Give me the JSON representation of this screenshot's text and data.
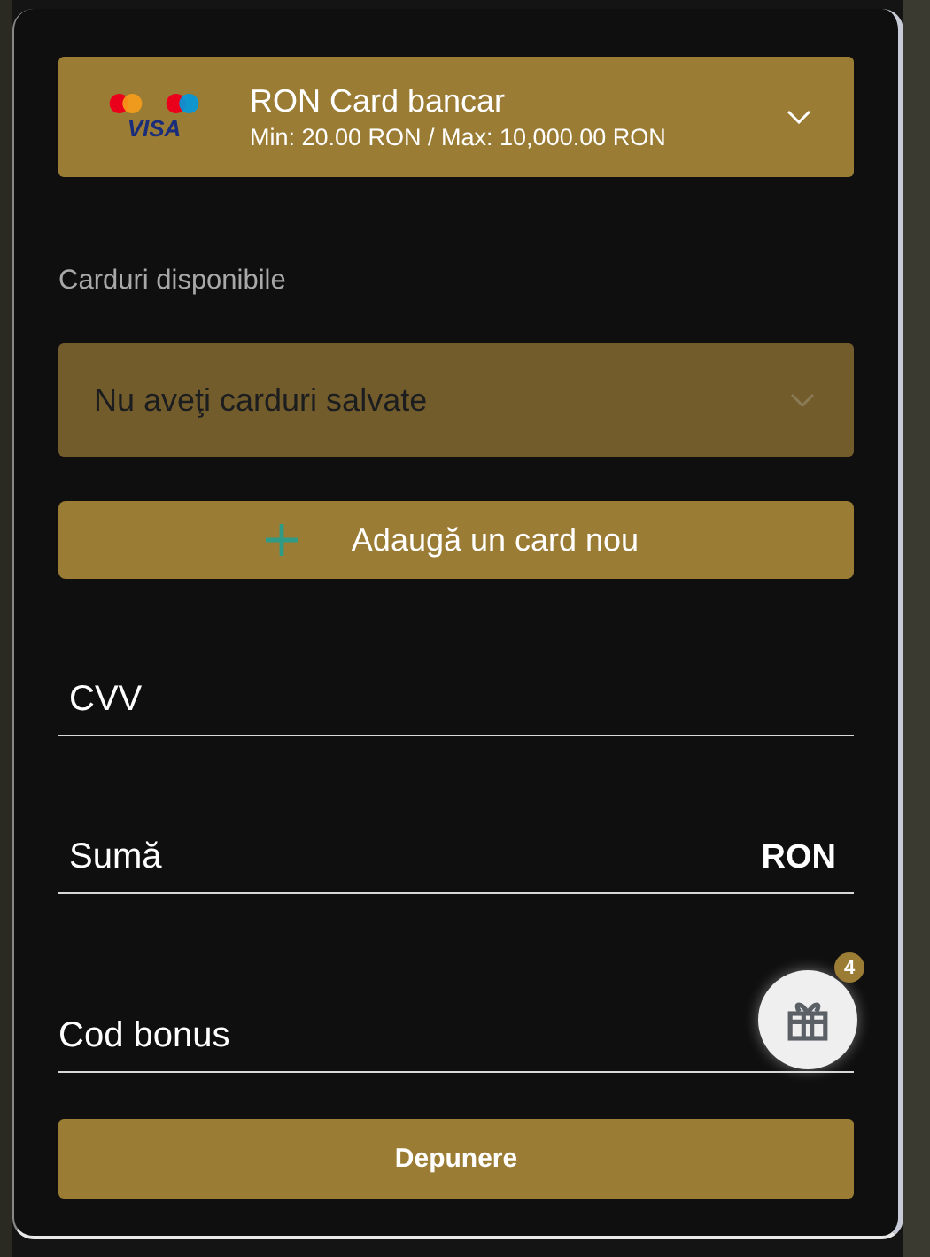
{
  "payment_method": {
    "visa_logo": "VISA",
    "title": "RON Card bancar",
    "limits": "Min: 20.00 RON / Max: 10,000.00 RON",
    "expanded": false
  },
  "saved_cards": {
    "label": "Carduri disponibile",
    "placeholder": "Nu aveţi carduri salvate",
    "disabled": true
  },
  "add_card_button": {
    "label": "Adaugă un card nou"
  },
  "fields": [
    {
      "kind": "text",
      "placeholder": "CVV"
    },
    {
      "kind": "amount",
      "placeholder": "Sumă",
      "suffix": "RON"
    },
    {
      "kind": "bonus",
      "placeholder": "Cod bonus"
    }
  ],
  "bonus_gift": {
    "badge": "4"
  },
  "submit_button": "Depunere"
}
